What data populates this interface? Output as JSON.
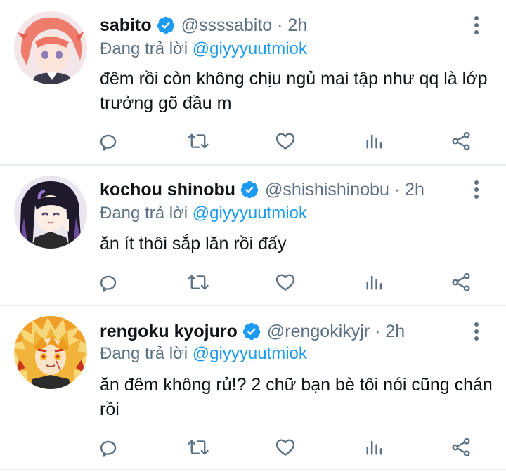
{
  "replying_prefix": "Đang trả lời",
  "colors": {
    "accent": "#1d9bf0",
    "muted": "#5b7083",
    "text": "#0f1419",
    "divider": "#e6ecf0"
  },
  "tweets": [
    {
      "display_name": "sabito",
      "handle_time": "@ssssabito · 2h",
      "replying_to": "@giyyyuutmiok",
      "text": "đêm rồi còn không chịu ngủ mai tập như qq là lớp trưởng gõ đầu m",
      "verified": true,
      "avatar_icon": "avatar-sabito"
    },
    {
      "display_name": "kochou shinobu",
      "handle_time": "@shishishinobu · 2h",
      "replying_to": "@giyyyuutmiok",
      "text": "ăn ít thôi sắp lăn rồi đấy",
      "verified": true,
      "avatar_icon": "avatar-shinobu"
    },
    {
      "display_name": "rengoku kyojuro",
      "handle_time": "@rengokikyjr · 2h",
      "replying_to": "@giyyyuutmiok",
      "text": "ăn đêm không rủ!? 2 chữ bạn bè tôi nói cũng chán rồi",
      "verified": true,
      "avatar_icon": "avatar-rengoku"
    }
  ],
  "action_icons": [
    "reply-icon",
    "retweet-icon",
    "like-icon",
    "analytics-icon",
    "share-icon"
  ]
}
